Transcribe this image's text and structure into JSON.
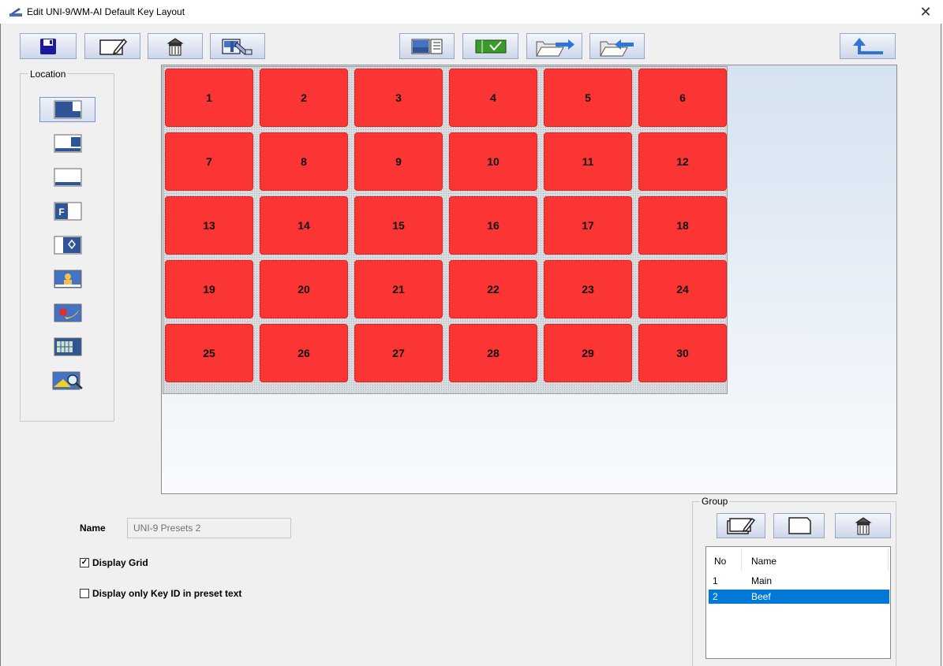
{
  "window": {
    "title": "Edit UNI-9/WM-AI Default Key Layout",
    "close_icon": "close-icon"
  },
  "toolbar": {
    "buttons": [
      {
        "name": "save-icon"
      },
      {
        "name": "edit-icon"
      },
      {
        "name": "delete-icon"
      },
      {
        "name": "paint-icon"
      },
      {
        "name": "list-view-icon"
      },
      {
        "name": "check-view-icon"
      },
      {
        "name": "export-folder-icon"
      },
      {
        "name": "import-folder-icon"
      },
      {
        "name": "back-arrow-icon"
      }
    ]
  },
  "location": {
    "legend": "Location",
    "buttons": [
      {
        "name": "location-bottom-left-icon",
        "selected": true
      },
      {
        "name": "location-bottom-right-icon",
        "selected": false
      },
      {
        "name": "location-full-bottom-icon",
        "selected": false
      },
      {
        "name": "location-f-icon",
        "selected": false
      },
      {
        "name": "location-diamond-icon",
        "selected": false
      },
      {
        "name": "location-person-icon",
        "selected": false
      },
      {
        "name": "location-food-icon",
        "selected": false
      },
      {
        "name": "location-grid-icon",
        "selected": false
      },
      {
        "name": "location-search-icon",
        "selected": false
      }
    ]
  },
  "keys": {
    "color": "#fb3434",
    "labels": [
      "1",
      "2",
      "3",
      "4",
      "5",
      "6",
      "7",
      "8",
      "9",
      "10",
      "11",
      "12",
      "13",
      "14",
      "15",
      "16",
      "17",
      "18",
      "19",
      "20",
      "21",
      "22",
      "23",
      "24",
      "25",
      "26",
      "27",
      "28",
      "29",
      "30"
    ]
  },
  "form": {
    "name_label": "Name",
    "name_value": "UNI-9 Presets 2",
    "display_grid_label": "Display Grid",
    "display_grid_checked": "✓",
    "key_id_label": "Display only Key ID in preset text"
  },
  "group": {
    "legend": "Group",
    "columns": {
      "no": "No",
      "name": "Name"
    },
    "rows": [
      {
        "no": "1",
        "name": "Main"
      },
      {
        "no": "2",
        "name": "Beef"
      }
    ],
    "selected_color": "#0078d7"
  }
}
